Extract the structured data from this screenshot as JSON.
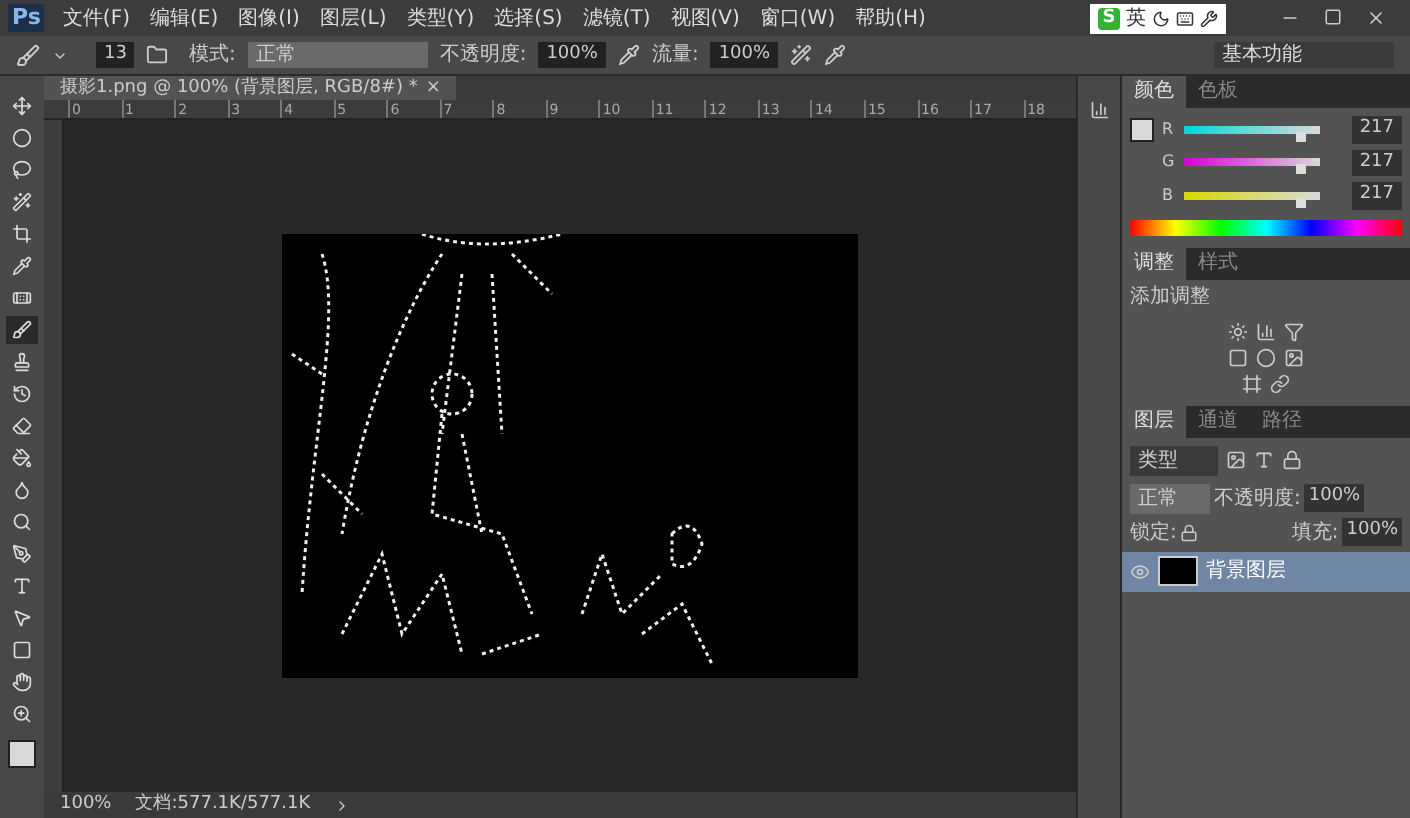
{
  "app": {
    "logo": "Ps"
  },
  "menu": [
    "文件(F)",
    "编辑(E)",
    "图像(I)",
    "图层(L)",
    "类型(Y)",
    "选择(S)",
    "滤镜(T)",
    "视图(V)",
    "窗口(W)",
    "帮助(H)"
  ],
  "ime": {
    "logo": "S",
    "mode": "英"
  },
  "options": {
    "brush_size": "13",
    "mode_label": "模式:",
    "mode": "正常",
    "opacity_label": "不透明度:",
    "opacity": "100%",
    "flow_label": "流量:",
    "flow": "100%"
  },
  "workspace": "基本功能",
  "document": {
    "tab": "摄影1.png @ 100% (背景图层, RGB/8#) *",
    "close": "×"
  },
  "ruler": [
    "0",
    "1",
    "2",
    "3",
    "4",
    "5",
    "6",
    "7",
    "8",
    "9",
    "10",
    "11",
    "12",
    "13",
    "14",
    "15",
    "16",
    "17",
    "18"
  ],
  "tools": [
    {
      "selected": false
    },
    {
      "selected": false
    },
    {
      "selected": false
    },
    {
      "selected": false
    },
    {
      "selected": false
    },
    {
      "selected": false
    },
    {
      "selected": false
    },
    {
      "selected": true
    },
    {
      "selected": false
    },
    {
      "selected": false
    },
    {
      "selected": false
    },
    {
      "selected": false
    },
    {
      "selected": false
    },
    {
      "selected": false
    },
    {
      "selected": false
    },
    {
      "selected": false
    },
    {
      "selected": false
    },
    {
      "selected": false
    },
    {
      "selected": false
    },
    {
      "selected": false
    }
  ],
  "color_panel": {
    "tabs": [
      {
        "label": "颜色",
        "selected": true
      },
      {
        "label": "色板",
        "selected": false
      }
    ],
    "channels": [
      {
        "label": "R",
        "value": "217",
        "level": 0.85
      },
      {
        "label": "G",
        "value": "217",
        "level": 0.85
      },
      {
        "label": "B",
        "value": "217",
        "level": 0.85
      }
    ]
  },
  "adjustments": {
    "tabs": [
      {
        "label": "调整",
        "selected": true
      },
      {
        "label": "样式",
        "selected": false
      }
    ],
    "title": "添加调整"
  },
  "layers": {
    "tabs": [
      {
        "label": "图层",
        "selected": true
      },
      {
        "label": "通道",
        "selected": false
      },
      {
        "label": "路径",
        "selected": false
      }
    ],
    "filter": "类型",
    "blend": "正常",
    "opacity_label": "不透明度:",
    "opacity": "100%",
    "lock_label": "锁定:",
    "fill_label": "填充:",
    "fill": "100%",
    "items": [
      {
        "name": "背景图层",
        "visible": true,
        "selected": true
      }
    ]
  },
  "status": {
    "zoom": "100%",
    "doc": "文档:577.1K/577.1K"
  }
}
